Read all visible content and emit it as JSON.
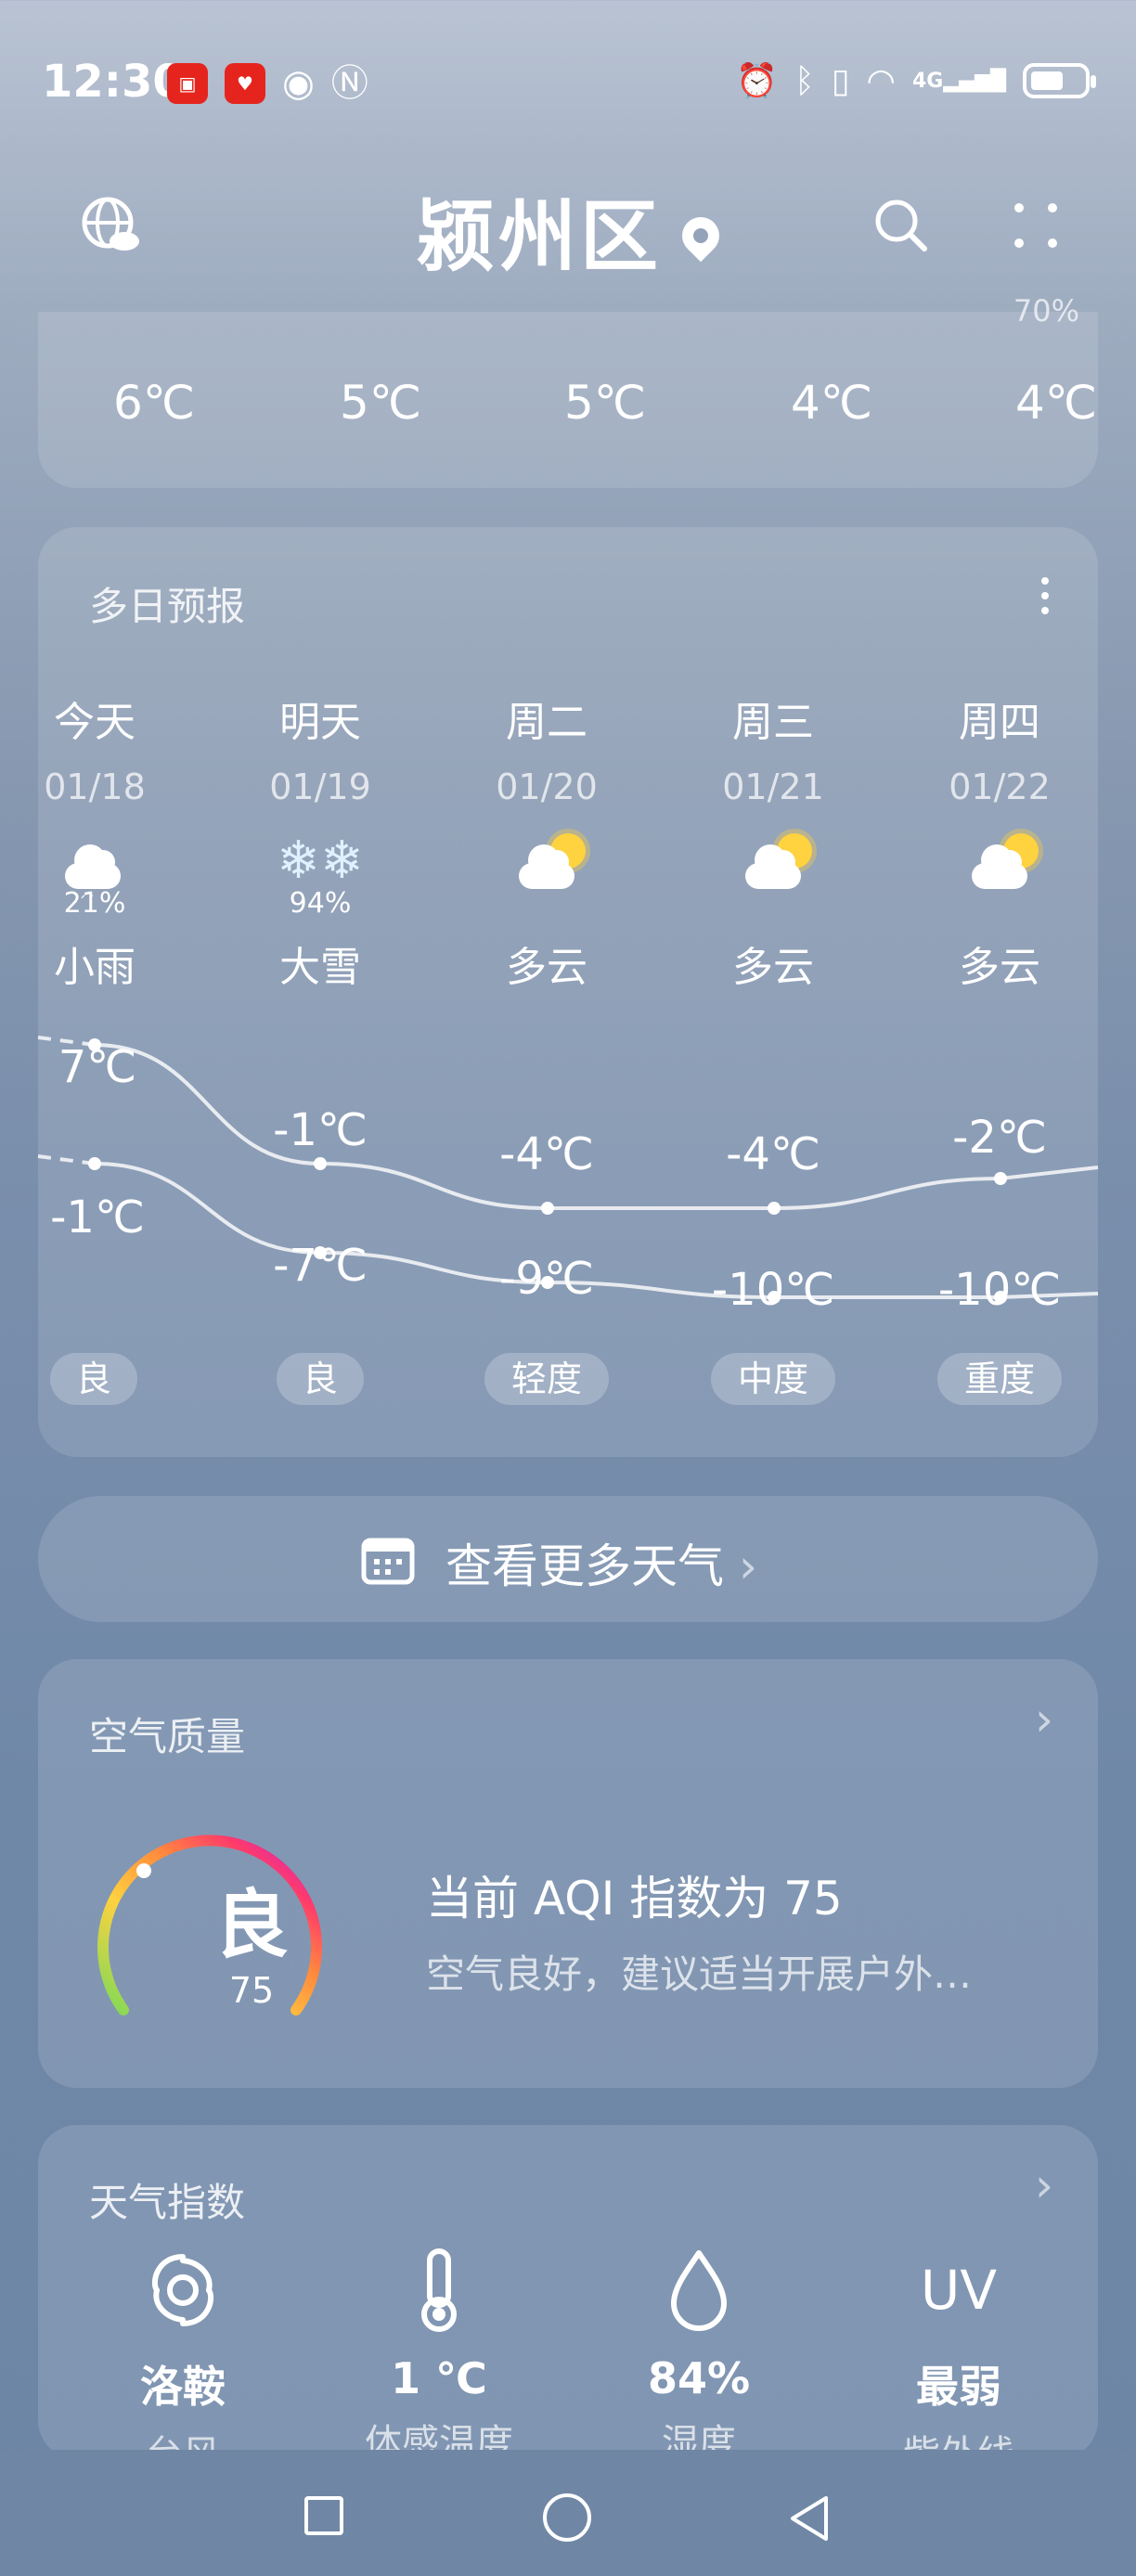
{
  "status_bar": {
    "time": "12:30",
    "left_icons": [
      "huawei-store-icon",
      "app-red-icon",
      "eye-icon",
      "nfc-icon"
    ],
    "right_icons": [
      "alarm-icon",
      "bluetooth-icon",
      "vibrate-icon",
      "wifi-icon",
      "4g-signal-icon",
      "battery-icon"
    ],
    "network_label": "4G"
  },
  "header": {
    "title": "颍州区",
    "left_icon": "globe-weather-icon",
    "right_icons": [
      "search-icon",
      "more-dots-icon"
    ]
  },
  "hourly": {
    "top_partial": "70%",
    "temps": [
      "6℃",
      "5℃",
      "5℃",
      "4℃",
      "4℃"
    ]
  },
  "daily": {
    "title": "多日预报",
    "days": [
      {
        "name": "今天",
        "date": "01/18",
        "icon": "light-rain-icon",
        "precip": "21%",
        "desc": "小雨",
        "high": "7℃",
        "low": "-1℃",
        "aqi": "良",
        "high_val": 7,
        "low_val": -1
      },
      {
        "name": "明天",
        "date": "01/19",
        "icon": "heavy-snow-icon",
        "precip": "94%",
        "desc": "大雪",
        "high": "-1℃",
        "low": "-7℃",
        "aqi": "良",
        "high_val": -1,
        "low_val": -7
      },
      {
        "name": "周二",
        "date": "01/20",
        "icon": "partly-cloudy-icon",
        "precip": "",
        "desc": "多云",
        "high": "-4℃",
        "low": "-9℃",
        "aqi": "轻度",
        "high_val": -4,
        "low_val": -9
      },
      {
        "name": "周三",
        "date": "01/21",
        "icon": "partly-cloudy-icon",
        "precip": "",
        "desc": "多云",
        "high": "-4℃",
        "low": "-10℃",
        "aqi": "中度",
        "high_val": -4,
        "low_val": -10
      },
      {
        "name": "周四",
        "date": "01/22",
        "icon": "partly-cloudy-icon",
        "precip": "",
        "desc": "多云",
        "high": "-2℃",
        "low": "-10℃",
        "aqi": "重度",
        "high_val": -2,
        "low_val": -10
      }
    ]
  },
  "more_weather": {
    "label": "查看更多天气"
  },
  "air_quality": {
    "title": "空气质量",
    "gauge_label": "良",
    "aqi_value": "75",
    "headline": "当前 AQI 指数为 75",
    "desc": "空气良好，建议适当开展户外…"
  },
  "weather_index": {
    "title": "天气指数",
    "items": [
      {
        "icon": "typhoon-icon",
        "value": "洛鞍",
        "label": "台风"
      },
      {
        "icon": "thermometer-icon",
        "value": "1 ℃",
        "label": "体感温度"
      },
      {
        "icon": "droplet-icon",
        "value": "84%",
        "label": "湿度"
      },
      {
        "icon": "uv-icon",
        "icon_text": "UV",
        "value": "最弱",
        "label": "紫外线"
      }
    ]
  },
  "colors": {
    "aqi_gradient": [
      "#7ed957",
      "#ffd23f",
      "#ff8a3d",
      "#ff3b6b",
      "#c21bd6"
    ],
    "sun": "#ffd23f"
  }
}
